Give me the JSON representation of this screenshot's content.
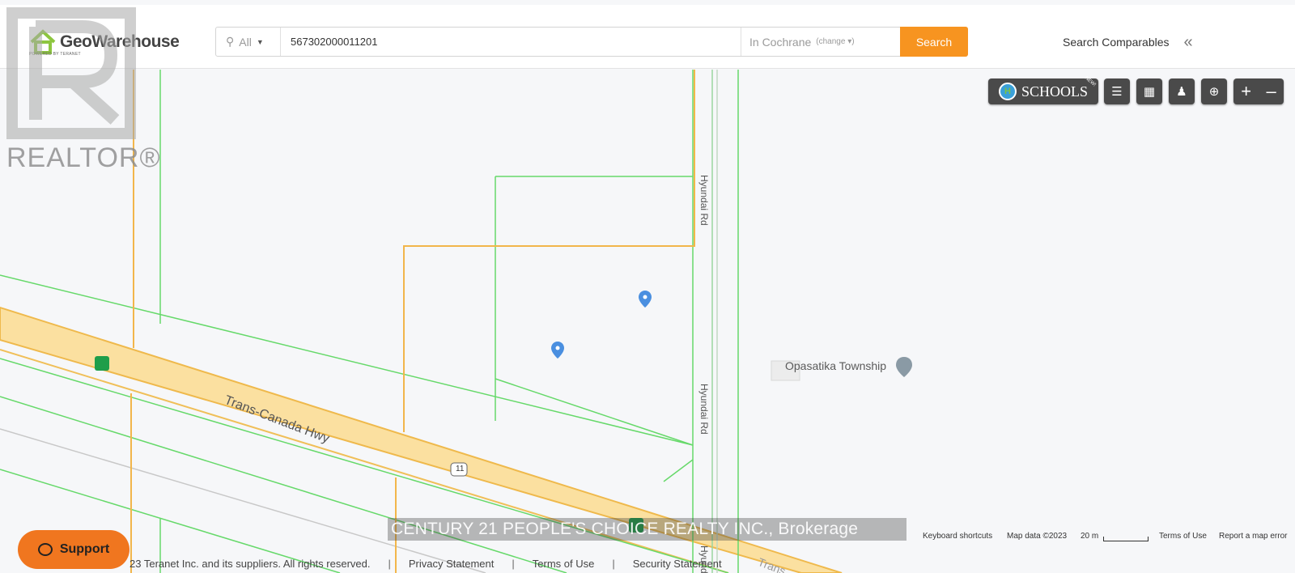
{
  "header": {
    "logo_text": "GeoWarehouse",
    "logo_sub": "POWERED BY TERANET",
    "search_type": "All",
    "search_value": "567302000011201",
    "location": "In Cochrane",
    "change_label": "(change ▾)",
    "search_button": "Search",
    "comparables_label": "Search Comparables",
    "collapse_icon": "double-chevron-left-icon"
  },
  "map_controls": {
    "schools_label": "SCHOOLS",
    "schools_badge": "NEW!",
    "buttons": [
      "layers-icon",
      "map-icon",
      "street-view-icon",
      "locate-icon",
      "zoom-in-icon",
      "zoom-out-icon"
    ]
  },
  "map": {
    "watermark_text": "REALTOR®",
    "place_label": "Opasatika Township",
    "road_labels": [
      "Hyundai Rd",
      "Hyundai Rd",
      "Hyundai Rd"
    ],
    "highway_label": "Trans-Canada Hwy",
    "highway_shield": "11",
    "highway_partial": "Trans",
    "brokerage": "CENTURY 21 PEOPLE'S CHOICE REALTY INC., Brokerage",
    "colors": {
      "parcel_green": "#66d96a",
      "parcel_orange": "#f2b64b",
      "highway_fill": "#fbe0a0",
      "pin_blue": "#4a8fe0"
    }
  },
  "attribution": {
    "keyboard": "Keyboard shortcuts",
    "map_data": "Map data ©2023",
    "scale": "20 m",
    "terms": "Terms of Use",
    "report": "Report a map error"
  },
  "support_label": "Support",
  "footer": {
    "copyright": "23 Teranet Inc. and its suppliers. All rights reserved.",
    "links": [
      "Privacy Statement",
      "Terms of Use",
      "Security Statement"
    ]
  }
}
